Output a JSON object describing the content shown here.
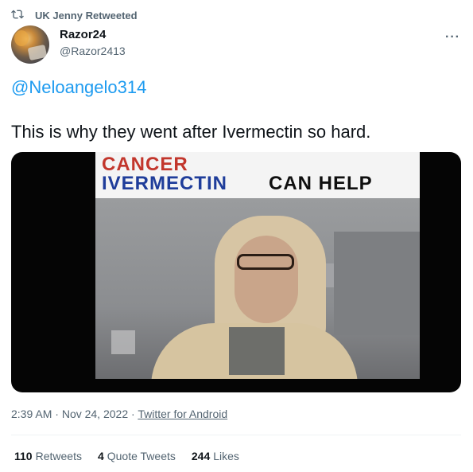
{
  "retweet": {
    "text": "UK Jenny Retweeted"
  },
  "author": {
    "name": "Razor24",
    "handle": "@Razor2413"
  },
  "more_icon": "more-horizontal-icon",
  "tweet": {
    "mention": "@Neloangelo314",
    "text": "This is why they went after Ivermectin so hard."
  },
  "media": {
    "banner_line1": "CANCER",
    "banner_line2_blue": "IVERMECTIN",
    "banner_line2_black": "CAN HELP"
  },
  "meta": {
    "time": "2:39 AM",
    "sep1": " · ",
    "date": "Nov 24, 2022",
    "sep2": " · ",
    "source": "Twitter for Android"
  },
  "stats": {
    "retweets_count": "110",
    "retweets_label": "Retweets",
    "quotes_count": "4",
    "quotes_label": "Quote Tweets",
    "likes_count": "244",
    "likes_label": "Likes"
  }
}
